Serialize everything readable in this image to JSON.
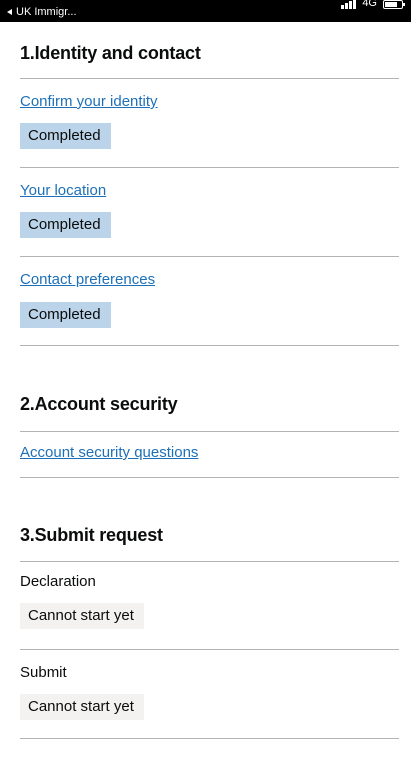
{
  "status_bar": {
    "back_label": "UK Immigr...",
    "network": "4G"
  },
  "sections": [
    {
      "title": "1.Identity and contact",
      "tasks": [
        {
          "label": "Confirm your identity",
          "link": true,
          "status": "Completed"
        },
        {
          "label": "Your location",
          "link": true,
          "status": "Completed"
        },
        {
          "label": "Contact preferences",
          "link": true,
          "status": "Completed"
        }
      ]
    },
    {
      "title": "2.Account security",
      "tasks": [
        {
          "label": "Account security questions",
          "link": true,
          "status": ""
        }
      ]
    },
    {
      "title": "3.Submit request",
      "tasks": [
        {
          "label": "Declaration",
          "link": false,
          "status": "Cannot start yet"
        },
        {
          "label": "Submit",
          "link": false,
          "status": "Cannot start yet"
        }
      ]
    }
  ],
  "colors": {
    "link": "#1d70b8",
    "completed_tag": "#bbd4ea",
    "cannot_start_tag": "#f3f2f1",
    "divider": "#b1b4b6"
  }
}
